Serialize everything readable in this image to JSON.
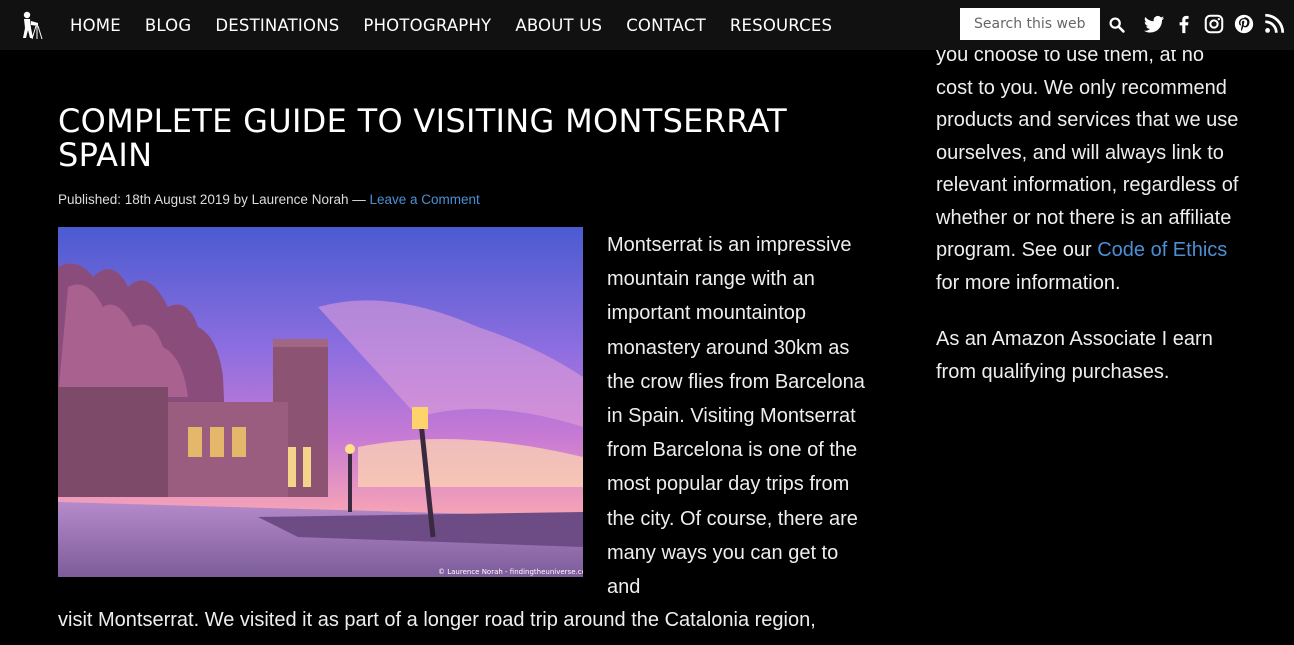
{
  "nav": {
    "items": [
      "HOME",
      "BLOG",
      "DESTINATIONS",
      "PHOTOGRAPHY",
      "ABOUT US",
      "CONTACT",
      "RESOURCES"
    ]
  },
  "search": {
    "placeholder": "Search this web"
  },
  "icons": [
    "photographer-logo-icon",
    "search-icon",
    "twitter-icon",
    "facebook-icon",
    "instagram-icon",
    "pinterest-icon",
    "rss-icon"
  ],
  "article": {
    "title": "COMPLETE GUIDE TO VISITING MONTSERRAT SPAIN",
    "published_prefix": "Published: 18th August 2019 by Laurence Norah — ",
    "comment_link": "Leave a Comment",
    "image_credit": "© Laurence Norah - findingtheuniverse.com",
    "intro": "Montserrat is an impressive mountain range with an important mountaintop monastery around 30km as the crow flies from Barcelona in Spain. Visiting Montserrat from Barcelona is one of the most popular day trips from the city. Of course, there are many ways you can get to and",
    "intro_continued": "visit Montserrat. We visited it as part of a longer road trip around the Catalonia region,"
  },
  "sidebar": {
    "disclosure_text": "you choose to use them, at no cost to you. We only recommend products and services that we use ourselves, and will always link to relevant information, regardless of whether or not there is an affiliate program. See our ",
    "ethics_link": "Code of Ethics",
    "disclosure_suffix": " for more information.",
    "amazon_text": "As an Amazon Associate I earn from qualifying purchases."
  },
  "colors": {
    "background": "#000000",
    "topbar": "#111111",
    "link": "#4a8fd6"
  }
}
